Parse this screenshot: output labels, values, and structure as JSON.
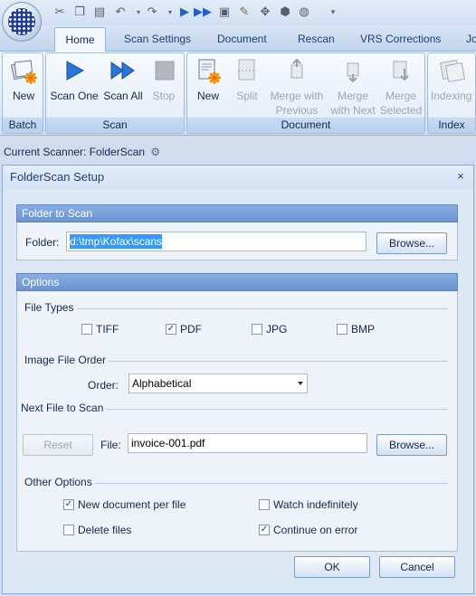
{
  "app": {
    "quick_access_icons": [
      "cut-icon",
      "copy-icon",
      "paste-icon",
      "undo-icon",
      "redo-icon",
      "scan-one-icon",
      "scan-all-icon",
      "scan-document-icon",
      "edit-icon",
      "batch-icon",
      "refresh-icon"
    ],
    "tabs": [
      "Home",
      "Scan Settings",
      "Document",
      "Rescan",
      "VRS Corrections",
      "Jo"
    ],
    "active_tab": "Home"
  },
  "ribbon": {
    "groups": {
      "batch": "Batch",
      "scan": "Scan",
      "document": "Document",
      "index": "Index"
    },
    "batch": {
      "new": "New"
    },
    "scan": {
      "scan_one": "Scan One",
      "scan_all": "Scan All",
      "stop": "Stop"
    },
    "document": {
      "new": "New",
      "split": "Split",
      "merge_prev_1": "Merge with",
      "merge_prev_2": "Previous",
      "merge_next_1": "Merge",
      "merge_next_2": "with Next",
      "merge_sel_1": "Merge",
      "merge_sel_2": "Selected"
    },
    "index": {
      "indexing": "Indexing"
    }
  },
  "scanner_bar": {
    "label": "Current Scanner: FolderScan"
  },
  "dialog": {
    "title": "FolderScan Setup",
    "close": "×",
    "folder_section": {
      "header": "Folder to Scan",
      "folder_label": "Folder:",
      "folder_value": "d:\\tmp\\Kofax\\scans",
      "browse": "Browse..."
    },
    "options_section": {
      "header": "Options",
      "file_types": {
        "label": "File Types",
        "tiff": "TIFF",
        "pdf": "PDF",
        "jpg": "JPG",
        "bmp": "BMP"
      },
      "image_order": {
        "label": "Image File Order",
        "order_label": "Order:",
        "order_value": "Alphabetical"
      },
      "next_file": {
        "label": "Next File to Scan",
        "reset": "Reset",
        "file_label": "File:",
        "file_value": "invoice-001.pdf",
        "browse": "Browse..."
      },
      "other": {
        "label": "Other Options",
        "new_doc_per_file": "New document per file",
        "watch_indefinitely": "Watch indefinitely",
        "delete_files": "Delete files",
        "continue_on_error": "Continue on error"
      }
    },
    "ok": "OK",
    "cancel": "Cancel"
  },
  "checks": {
    "tiff": "",
    "pdf": "✓",
    "jpg": "",
    "bmp": "",
    "new_doc_per_file": "✓",
    "watch_indefinitely": "",
    "delete_files": "",
    "continue_on_error": "✓"
  }
}
